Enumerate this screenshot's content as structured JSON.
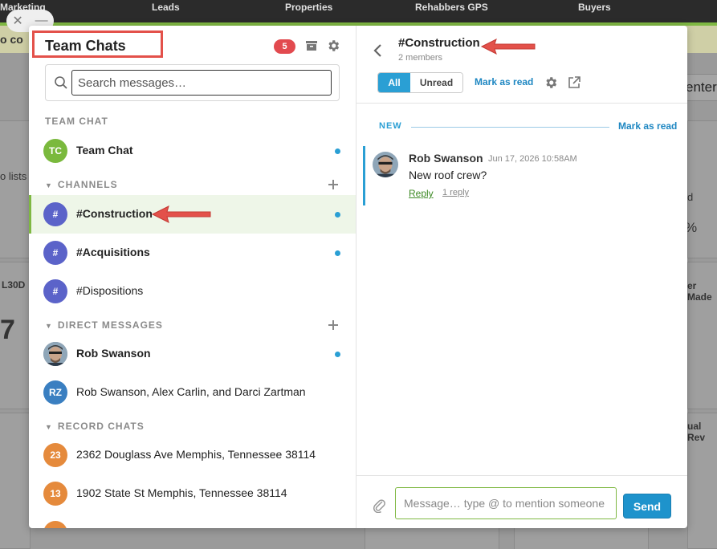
{
  "background": {
    "nav": [
      "Marketing",
      "Leads",
      "Properties",
      "Rehabbers GPS",
      "Buyers"
    ],
    "banner_text": "o co",
    "left_text_1": "o lists",
    "left_text_2": "L30D",
    "left_text_3": "7",
    "right_text_1": "d",
    "right_text_2": "%",
    "right_text_3": "er Made",
    "right_text_4": "ual Rev",
    "button_label": "enter"
  },
  "window_controls": {
    "close": "✕",
    "minimize": "—"
  },
  "sidebar": {
    "title": "Team Chats",
    "unread_badge": "5",
    "search": {
      "placeholder": "Search messages…",
      "value": ""
    },
    "team_chat": {
      "header": "TEAM CHAT",
      "item": {
        "initials": "TC",
        "label": "Team Chat",
        "color": "#7ab93d",
        "unread": true
      }
    },
    "channels": {
      "header": "CHANNELS",
      "items": [
        {
          "initials": "#",
          "label": "#Construction",
          "color": "#5b63c9",
          "unread": true,
          "active": true,
          "bold": true
        },
        {
          "initials": "#",
          "label": "#Acquisitions",
          "color": "#5b63c9",
          "unread": true,
          "active": false,
          "bold": true
        },
        {
          "initials": "#",
          "label": "#Dispositions",
          "color": "#5b63c9",
          "unread": false,
          "active": false,
          "bold": false
        }
      ]
    },
    "direct_messages": {
      "header": "DIRECT MESSAGES",
      "items": [
        {
          "initials": "",
          "label": "Rob Swanson",
          "color": "#6d7f8f",
          "unread": true,
          "bold": true,
          "photo": true
        },
        {
          "initials": "RZ",
          "label": "Rob Swanson, Alex Carlin, and Darci Zartman",
          "color": "#3a7fc1",
          "unread": false,
          "bold": false
        }
      ]
    },
    "record_chats": {
      "header": "RECORD CHATS",
      "items": [
        {
          "initials": "23",
          "label": "2362 Douglass Ave Memphis, Tennessee 38114",
          "color": "#e58a3c"
        },
        {
          "initials": "13",
          "label": "1902 State St Memphis, Tennessee 38114",
          "color": "#e58a3c"
        }
      ]
    }
  },
  "conversation": {
    "title": "#Construction",
    "members": "2 members",
    "filters": {
      "all": "All",
      "unread": "Unread"
    },
    "mark_as_read": "Mark as read",
    "new_label": "NEW",
    "new_mark_as_read": "Mark as read",
    "messages": [
      {
        "author": "Rob Swanson",
        "timestamp": "Jun 17, 2026 10:58AM",
        "text": "New roof crew?",
        "reply": "Reply",
        "replies": "1 reply"
      }
    ],
    "composer": {
      "placeholder": "Message… type @ to mention someone",
      "send": "Send"
    }
  },
  "colors": {
    "accent_blue": "#2a9fd4",
    "accent_green": "#7fb843",
    "badge_red": "#e24a4f",
    "annotation_red": "#e3514a"
  }
}
